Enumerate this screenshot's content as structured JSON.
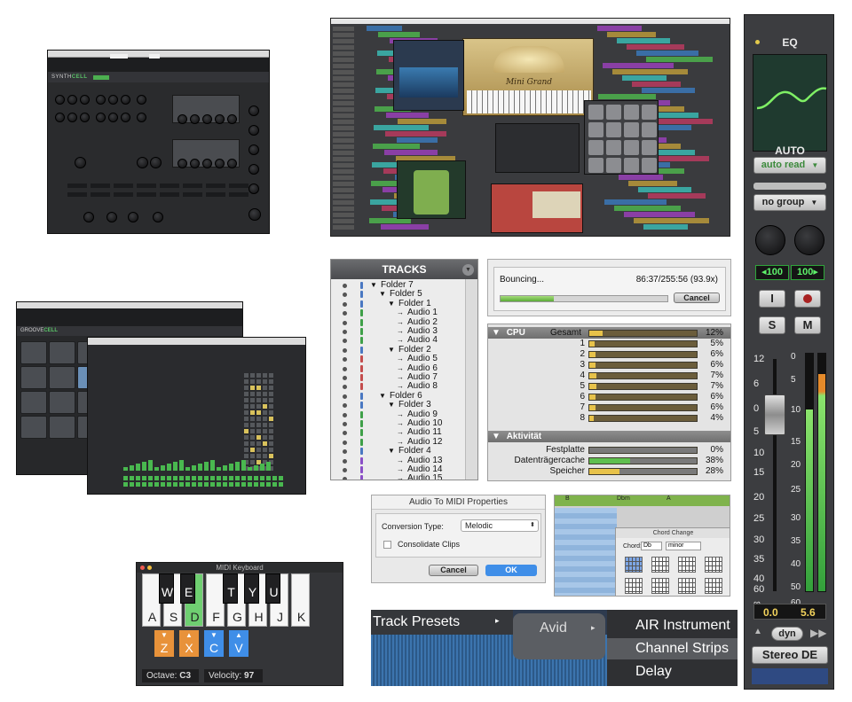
{
  "synthcell": {
    "brand_synth": "SYNTH",
    "brand_cell": "CELL"
  },
  "groovecell": {
    "brand_groove": "GROOVE",
    "brand_cell": "CELL"
  },
  "daw": {
    "plugin_name": "Mini Grand"
  },
  "channel_strip": {
    "eq_label": "EQ",
    "auto_label": "AUTO",
    "auto_mode": "auto read",
    "group": "no group",
    "pan_left": "100",
    "pan_right": "100",
    "input_btn": "I",
    "solo_btn": "S",
    "mute_btn": "M",
    "fader_scale": [
      "12",
      "6",
      "0",
      "5",
      "10",
      "15",
      "20",
      "25",
      "30",
      "35",
      "40",
      "60",
      "∞"
    ],
    "meter_scale": [
      "0",
      "5",
      "10",
      "15",
      "20",
      "25",
      "30",
      "35",
      "40",
      "50",
      "60"
    ],
    "level_left": "0.0",
    "level_right": "5.6",
    "dyn_label": "dyn",
    "output": "Stereo DE"
  },
  "tracks_panel": {
    "title": "TRACKS",
    "items": [
      {
        "label": "Folder 7",
        "indent": 0,
        "color": "#4a78c2"
      },
      {
        "label": "Folder 5",
        "indent": 1,
        "color": "#4a78c2"
      },
      {
        "label": "Folder 1",
        "indent": 2,
        "color": "#4a78c2"
      },
      {
        "label": "Audio 1",
        "indent": 3,
        "color": "#3fa049"
      },
      {
        "label": "Audio 2",
        "indent": 3,
        "color": "#3fa049"
      },
      {
        "label": "Audio 3",
        "indent": 3,
        "color": "#3fa049"
      },
      {
        "label": "Audio 4",
        "indent": 3,
        "color": "#3fa049"
      },
      {
        "label": "Folder 2",
        "indent": 2,
        "color": "#4a78c2"
      },
      {
        "label": "Audio 5",
        "indent": 3,
        "color": "#c44d4d"
      },
      {
        "label": "Audio 6",
        "indent": 3,
        "color": "#c44d4d"
      },
      {
        "label": "Audio 7",
        "indent": 3,
        "color": "#c44d4d"
      },
      {
        "label": "Audio 8",
        "indent": 3,
        "color": "#c44d4d"
      },
      {
        "label": "Folder 6",
        "indent": 1,
        "color": "#4a78c2"
      },
      {
        "label": "Folder 3",
        "indent": 2,
        "color": "#4a78c2"
      },
      {
        "label": "Audio 9",
        "indent": 3,
        "color": "#3fa049"
      },
      {
        "label": "Audio 10",
        "indent": 3,
        "color": "#3fa049"
      },
      {
        "label": "Audio 11",
        "indent": 3,
        "color": "#3fa049"
      },
      {
        "label": "Audio 12",
        "indent": 3,
        "color": "#3fa049"
      },
      {
        "label": "Folder 4",
        "indent": 2,
        "color": "#4a78c2"
      },
      {
        "label": "Audio 13",
        "indent": 3,
        "color": "#8a4fc7"
      },
      {
        "label": "Audio 14",
        "indent": 3,
        "color": "#8a4fc7"
      },
      {
        "label": "Audio 15",
        "indent": 3,
        "color": "#8a4fc7"
      }
    ]
  },
  "bounce": {
    "status": "Bouncing...",
    "time": "86:37/255:56 (93.9x)",
    "progress": 0.32,
    "cancel": "Cancel"
  },
  "cpu": {
    "section_title": "CPU",
    "rows": [
      {
        "label": "Gesamt",
        "value": "12%",
        "fraction": 0.12
      },
      {
        "label": "1",
        "value": "5%",
        "fraction": 0.05
      },
      {
        "label": "2",
        "value": "6%",
        "fraction": 0.06
      },
      {
        "label": "3",
        "value": "6%",
        "fraction": 0.06
      },
      {
        "label": "4",
        "value": "7%",
        "fraction": 0.07
      },
      {
        "label": "5",
        "value": "7%",
        "fraction": 0.07
      },
      {
        "label": "6",
        "value": "6%",
        "fraction": 0.06
      },
      {
        "label": "7",
        "value": "6%",
        "fraction": 0.06
      },
      {
        "label": "8",
        "value": "4%",
        "fraction": 0.04
      }
    ],
    "activity_title": "Aktivität",
    "activity": [
      {
        "label": "Festplatte",
        "value": "0%",
        "fraction": 0.0,
        "color": "#5fbf4f"
      },
      {
        "label": "Datenträgercache",
        "value": "38%",
        "fraction": 0.38,
        "color": "#5fbf4f"
      },
      {
        "label": "Speicher",
        "value": "28%",
        "fraction": 0.28,
        "color": "#e7c24a"
      }
    ]
  },
  "audio_to_midi": {
    "title": "Audio To MIDI Properties",
    "conversion_label": "Conversion Type:",
    "conversion_value": "Melodic",
    "consolidate": "Consolidate Clips",
    "cancel": "Cancel",
    "ok": "OK"
  },
  "chord_change": {
    "title": "Chord Change",
    "chord_label": "Chord:",
    "root": "Db",
    "quality": "minor",
    "marker_b": "B",
    "marker_dbm": "Dbm",
    "marker_a": "A"
  },
  "midi_keyboard": {
    "title": "MIDI Keyboard",
    "white_keys": [
      "A",
      "S",
      "D",
      "F",
      "G",
      "H",
      "J",
      "K"
    ],
    "black_keys": [
      "W",
      "E",
      "T",
      "Y",
      "U"
    ],
    "z_keys": [
      "Z",
      "X",
      "C",
      "V"
    ],
    "octave_label": "Octave:",
    "octave_value": "C3",
    "velocity_label": "Velocity:",
    "velocity_value": "97"
  },
  "track_presets": {
    "menu_title": "Track Presets",
    "submenu": "Avid",
    "items": [
      "AIR Instrument",
      "Channel Strips",
      "Delay"
    ]
  },
  "colors": {
    "accent_green": "#59c167",
    "meter_green": "#4fbf4f",
    "cpu_yellow": "#e7c24a",
    "ok_blue": "#3f8ee8"
  }
}
